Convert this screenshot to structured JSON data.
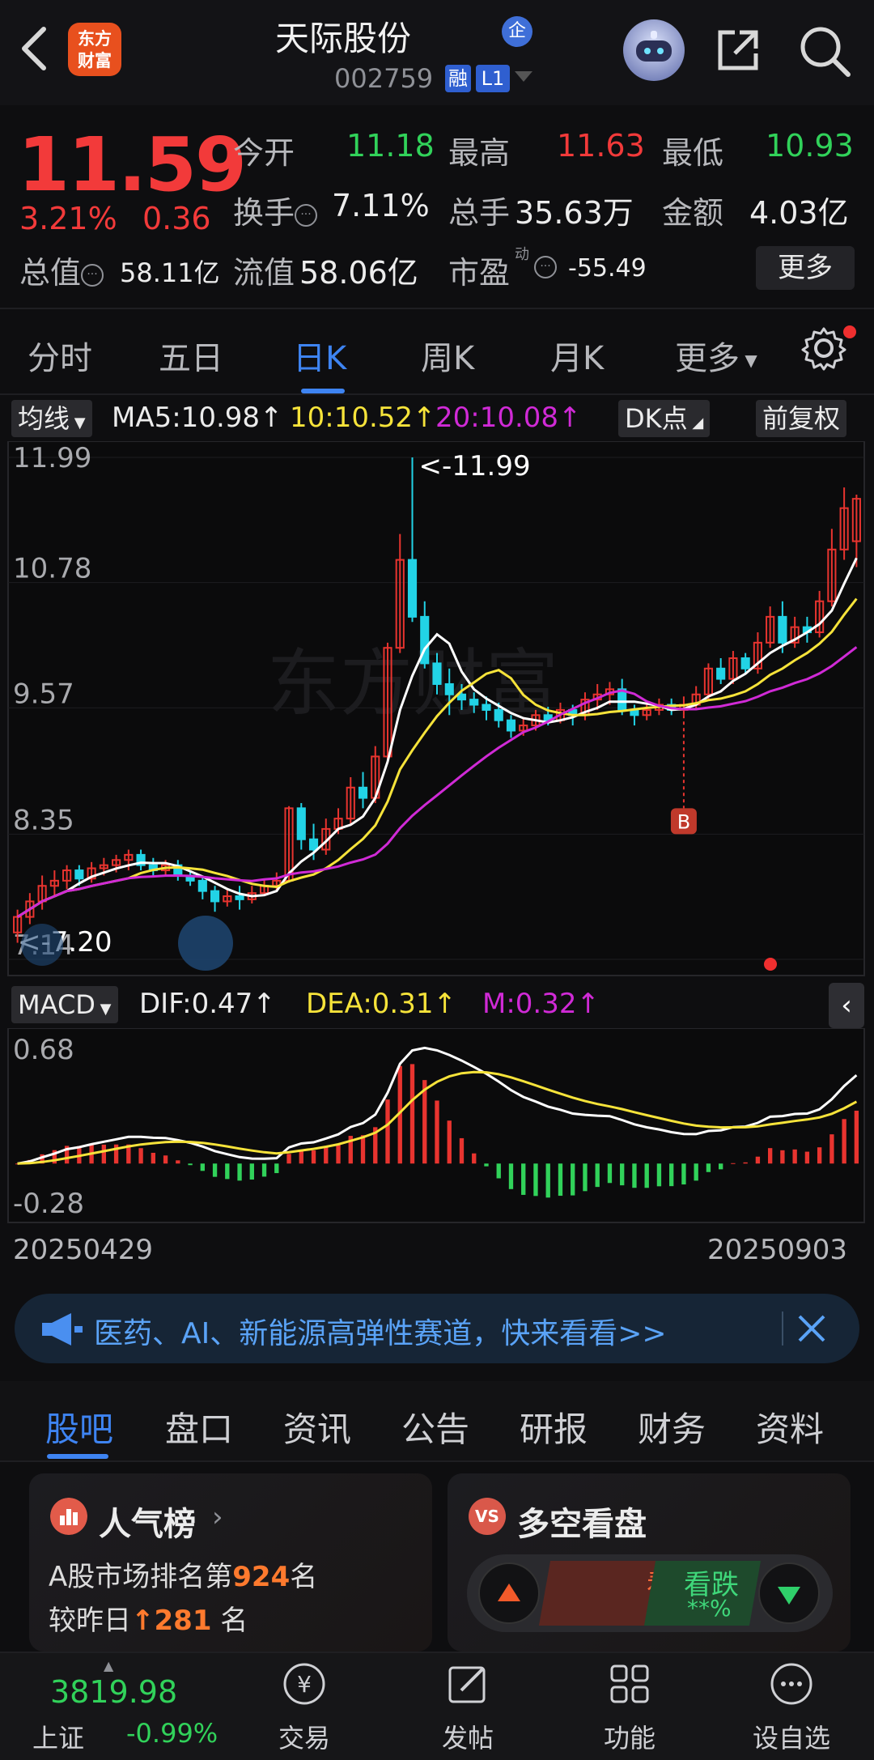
{
  "header": {
    "logo_text_1": "东方",
    "logo_text_2": "财富",
    "title": "天际股份",
    "qi_badge": "企",
    "code": "002759",
    "rong_badge": "融",
    "level_badge": "L1"
  },
  "quote": {
    "price": "11.59",
    "change_pct": "3.21%",
    "change": "0.36",
    "open_label": "今开",
    "open": "11.18",
    "high_label": "最高",
    "high": "11.63",
    "low_label": "最低",
    "low": "10.93",
    "turnover_label": "换手",
    "turnover": "7.11%",
    "volume_label": "总手",
    "volume": "35.63万",
    "amount_label": "金额",
    "amount": "4.03亿",
    "mktcap_label": "总值",
    "mktcap": "58.11亿",
    "float_label": "流值",
    "float_cap": "58.06亿",
    "pe_label": "市盈",
    "pe_sup": "动",
    "pe": "-55.49",
    "more": "更多"
  },
  "kline_tabs": [
    "分时",
    "五日",
    "日K",
    "周K",
    "月K",
    "更多"
  ],
  "ma_bar": {
    "ma_select": "均线",
    "ma5": "MA5:10.98↑",
    "ma10": "10:10.52↑",
    "ma20": "20:10.08↑",
    "dk": "DK点",
    "fq": "前复权"
  },
  "macd_bar": {
    "macd_select": "MACD",
    "dif": "DIF:0.47↑",
    "dea": "DEA:0.31↑",
    "m": "M:0.32↑"
  },
  "dates": {
    "start": "20250429",
    "end": "20250903"
  },
  "banner": {
    "text": "医药、AI、新能源高弹性赛道，快来看看>>"
  },
  "section_tabs": [
    "股吧",
    "盘口",
    "资讯",
    "公告",
    "研报",
    "财务",
    "资料"
  ],
  "card_popularity": {
    "title": "人气榜",
    "line1_prefix": "A股市场排名第",
    "rank": "924",
    "line1_suffix": "名",
    "line2_prefix": "较昨日",
    "change": "281",
    "line2_suffix": " 名"
  },
  "card_bullbear": {
    "badge": "VS",
    "title": "多空看盘",
    "bull_label": "看涨",
    "bull_value": "**%",
    "bear_label": "看跌",
    "bear_value": "**%"
  },
  "bottom_nav": {
    "index_value": "3819.98",
    "index_name": "上证",
    "index_change": "-0.99%",
    "items": [
      "交易",
      "发帖",
      "功能",
      "设自选"
    ]
  },
  "colors": {
    "up": "#f23a3a",
    "down": "#31d25a",
    "accent": "#3e84f2",
    "ma5": "#ffffff",
    "ma10": "#f6e33a",
    "ma20": "#d02ad6"
  },
  "chart_data": {
    "type": "candlestick",
    "x_range": [
      "20250429",
      "20250903"
    ],
    "ylim": [
      7.14,
      11.99
    ],
    "y_ticks": [
      "11.99",
      "10.78",
      "9.57",
      "8.35",
      "7.14"
    ],
    "annotations": [
      "<-11.99",
      "<-7.20",
      "B"
    ],
    "macd": {
      "y_ticks": [
        "0.68",
        "-0.28"
      ],
      "dif": 0.47,
      "dea": 0.31,
      "m": 0.32
    },
    "candles": [
      [
        7.4,
        7.55,
        7.3,
        7.62
      ],
      [
        7.55,
        7.7,
        7.48,
        7.78
      ],
      [
        7.7,
        7.85,
        7.62,
        7.95
      ],
      [
        7.85,
        7.9,
        7.75,
        8.0
      ],
      [
        7.9,
        8.0,
        7.82,
        8.05
      ],
      [
        8.0,
        7.92,
        7.85,
        8.05
      ],
      [
        7.92,
        8.02,
        7.88,
        8.08
      ],
      [
        8.02,
        8.05,
        7.95,
        8.12
      ],
      [
        8.05,
        8.1,
        7.98,
        8.15
      ],
      [
        8.1,
        8.15,
        8.0,
        8.2
      ],
      [
        8.15,
        8.05,
        8.0,
        8.2
      ],
      [
        8.05,
        8.0,
        7.95,
        8.12
      ],
      [
        8.0,
        8.05,
        7.95,
        8.1
      ],
      [
        8.05,
        7.95,
        7.9,
        8.1
      ],
      [
        7.95,
        7.9,
        7.85,
        8.0
      ],
      [
        7.9,
        7.8,
        7.72,
        7.95
      ],
      [
        7.8,
        7.7,
        7.6,
        7.85
      ],
      [
        7.7,
        7.75,
        7.65,
        7.82
      ],
      [
        7.75,
        7.72,
        7.62,
        7.85
      ],
      [
        7.72,
        7.78,
        7.68,
        7.85
      ],
      [
        7.78,
        7.85,
        7.75,
        7.92
      ],
      [
        7.85,
        7.9,
        7.8,
        7.98
      ],
      [
        7.9,
        8.6,
        7.88,
        8.62
      ],
      [
        8.6,
        8.3,
        8.2,
        8.65
      ],
      [
        8.3,
        8.2,
        8.1,
        8.45
      ],
      [
        8.2,
        8.4,
        8.15,
        8.5
      ],
      [
        8.4,
        8.5,
        8.35,
        8.6
      ],
      [
        8.5,
        8.8,
        8.45,
        8.9
      ],
      [
        8.8,
        8.7,
        8.6,
        8.95
      ],
      [
        8.7,
        9.1,
        8.65,
        9.2
      ],
      [
        9.1,
        10.15,
        9.05,
        10.2
      ],
      [
        10.15,
        11.0,
        10.1,
        11.25
      ],
      [
        11.0,
        10.45,
        10.4,
        11.99
      ],
      [
        10.45,
        10.0,
        9.95,
        10.6
      ],
      [
        10.0,
        9.8,
        9.7,
        10.1
      ],
      [
        9.8,
        9.7,
        9.5,
        9.95
      ],
      [
        9.7,
        9.65,
        9.55,
        9.8
      ],
      [
        9.65,
        9.6,
        9.52,
        9.72
      ],
      [
        9.6,
        9.55,
        9.45,
        9.68
      ],
      [
        9.55,
        9.45,
        9.38,
        9.62
      ],
      [
        9.45,
        9.35,
        9.28,
        9.5
      ],
      [
        9.35,
        9.4,
        9.3,
        9.48
      ],
      [
        9.4,
        9.5,
        9.35,
        9.55
      ],
      [
        9.5,
        9.45,
        9.4,
        9.58
      ],
      [
        9.45,
        9.55,
        9.42,
        9.62
      ],
      [
        9.55,
        9.5,
        9.4,
        9.6
      ],
      [
        9.5,
        9.65,
        9.45,
        9.72
      ],
      [
        9.65,
        9.7,
        9.55,
        9.8
      ],
      [
        9.7,
        9.75,
        9.6,
        9.82
      ],
      [
        9.75,
        9.55,
        9.5,
        9.85
      ],
      [
        9.55,
        9.5,
        9.4,
        9.6
      ],
      [
        9.5,
        9.55,
        9.45,
        9.62
      ],
      [
        9.55,
        9.6,
        9.5,
        9.66
      ],
      [
        9.6,
        9.55,
        9.5,
        9.66
      ],
      [
        9.55,
        9.6,
        9.5,
        9.68
      ],
      [
        9.6,
        9.7,
        9.55,
        9.78
      ],
      [
        9.7,
        9.95,
        9.65,
        10.0
      ],
      [
        9.95,
        9.85,
        9.8,
        10.05
      ],
      [
        9.85,
        10.05,
        9.8,
        10.12
      ],
      [
        10.05,
        9.95,
        9.9,
        10.1
      ],
      [
        9.95,
        10.2,
        9.9,
        10.3
      ],
      [
        10.2,
        10.45,
        10.15,
        10.55
      ],
      [
        10.45,
        10.2,
        10.1,
        10.6
      ],
      [
        10.2,
        10.35,
        10.15,
        10.45
      ],
      [
        10.35,
        10.3,
        10.2,
        10.45
      ],
      [
        10.3,
        10.6,
        10.25,
        10.7
      ],
      [
        10.6,
        11.1,
        10.55,
        11.3
      ],
      [
        11.1,
        11.5,
        11.0,
        11.7
      ],
      [
        11.18,
        11.59,
        10.93,
        11.63
      ]
    ]
  }
}
